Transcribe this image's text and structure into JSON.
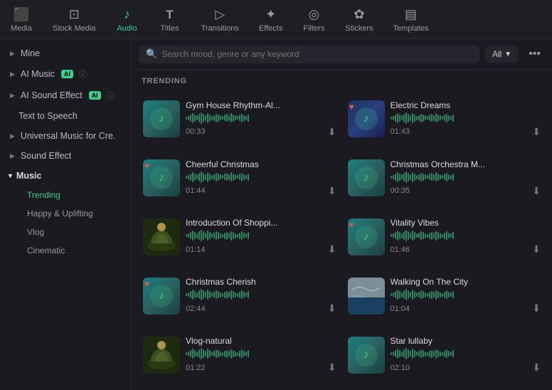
{
  "nav": {
    "items": [
      {
        "id": "media",
        "label": "Media",
        "icon": "⊞"
      },
      {
        "id": "stock-media",
        "label": "Stock Media",
        "icon": "⊡"
      },
      {
        "id": "audio",
        "label": "Audio",
        "icon": "♪",
        "active": true
      },
      {
        "id": "titles",
        "label": "Titles",
        "icon": "T"
      },
      {
        "id": "transitions",
        "label": "Transitions",
        "icon": "▷"
      },
      {
        "id": "effects",
        "label": "Effects",
        "icon": "✦"
      },
      {
        "id": "filters",
        "label": "Filters",
        "icon": "◎"
      },
      {
        "id": "stickers",
        "label": "Stickers",
        "icon": "✿"
      },
      {
        "id": "templates",
        "label": "Templates",
        "icon": "⊟"
      }
    ]
  },
  "sidebar": {
    "items": [
      {
        "id": "mine",
        "label": "Mine",
        "type": "collapsible",
        "chevron": "▶"
      },
      {
        "id": "ai-music",
        "label": "AI Music",
        "type": "collapsible",
        "chevron": "▶",
        "badge": "AI",
        "info": true
      },
      {
        "id": "ai-sound-effect",
        "label": "AI Sound Effect",
        "type": "collapsible",
        "chevron": "▶",
        "badge": "AI",
        "info": true
      },
      {
        "id": "text-to-speech",
        "label": "Text to Speech",
        "type": "plain"
      },
      {
        "id": "universal-music",
        "label": "Universal Music for Cre.",
        "type": "collapsible",
        "chevron": "▶"
      },
      {
        "id": "sound-effect",
        "label": "Sound Effect",
        "type": "collapsible",
        "chevron": "▶"
      },
      {
        "id": "music",
        "label": "Music",
        "type": "section",
        "chevron": "▼",
        "open": true
      },
      {
        "id": "trending",
        "label": "Trending",
        "type": "subitem",
        "active": true
      },
      {
        "id": "happy-uplifting",
        "label": "Happy & Uplifting",
        "type": "subitem"
      },
      {
        "id": "vlog",
        "label": "Vlog",
        "type": "subitem"
      },
      {
        "id": "cinematic",
        "label": "Cinematic",
        "type": "subitem"
      }
    ]
  },
  "search": {
    "placeholder": "Search mood, genre or any keyword",
    "filter_label": "All"
  },
  "trending_label": "TRENDING",
  "tracks": [
    {
      "id": 1,
      "name": "Gym House Rhythm-Al...",
      "duration": "00:33",
      "thumb": "teal",
      "heart": false
    },
    {
      "id": 2,
      "name": "Electric Dreams",
      "duration": "01:43",
      "thumb": "blue",
      "heart": true
    },
    {
      "id": 3,
      "name": "Cheerful Christmas",
      "duration": "01:44",
      "thumb": "teal",
      "heart": true
    },
    {
      "id": 4,
      "name": "Christmas Orchestra M...",
      "duration": "00:35",
      "thumb": "teal",
      "heart": false
    },
    {
      "id": 5,
      "name": "Introduction Of Shoppi...",
      "duration": "01:14",
      "thumb": "nature",
      "heart": false
    },
    {
      "id": 6,
      "name": "Vitality Vibes",
      "duration": "01:46",
      "thumb": "teal",
      "heart": true
    },
    {
      "id": 7,
      "name": "Christmas Cherish",
      "duration": "02:44",
      "thumb": "teal",
      "heart": true
    },
    {
      "id": 8,
      "name": "Walking On The City",
      "duration": "01:04",
      "thumb": "ocean",
      "heart": false
    },
    {
      "id": 9,
      "name": "Vlog-natural",
      "duration": "01:22",
      "thumb": "nature",
      "heart": false
    },
    {
      "id": 10,
      "name": "Star lullaby",
      "duration": "02:10",
      "thumb": "teal",
      "heart": false
    }
  ]
}
